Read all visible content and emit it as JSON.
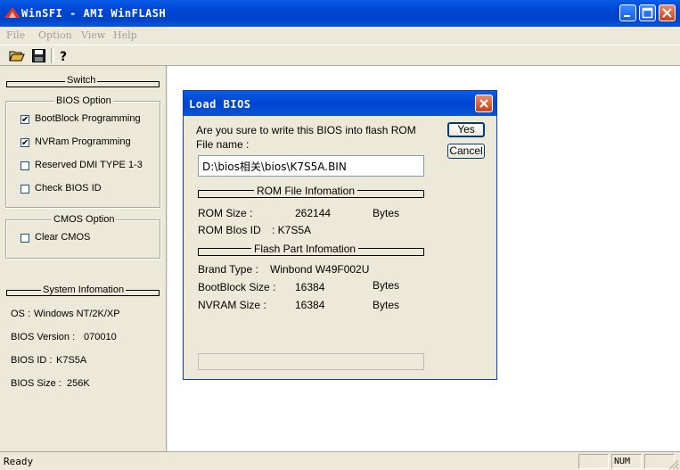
{
  "window": {
    "title": "WinSFI - AMI WinFLASH",
    "controls": [
      "minimize-icon",
      "maximize-icon",
      "close-icon"
    ]
  },
  "menu": {
    "items": [
      "File",
      "Option",
      "View",
      "Help"
    ]
  },
  "toolbar": {
    "buttons": [
      "open-folder-icon",
      "save-icon",
      "help-icon"
    ]
  },
  "left_panel": {
    "switch_heading": "Switch",
    "bios_option": {
      "title": "BIOS Option",
      "items": [
        {
          "label": "BootBlock Programming",
          "checked": true
        },
        {
          "label": "NVRam Programming",
          "checked": true
        },
        {
          "label": "Reserved DMI TYPE 1-3",
          "checked": false
        },
        {
          "label": "Check BIOS ID",
          "checked": false
        }
      ]
    },
    "cmos_option": {
      "title": "CMOS Option",
      "items": [
        {
          "label": "Clear CMOS",
          "checked": false
        }
      ]
    },
    "system_info": {
      "heading": "System Infomation",
      "os_label": "OS :",
      "os_value": "Windows NT/2K/XP",
      "bios_version_label": "BIOS Version :",
      "bios_version_value": "070010",
      "bios_id_label": "BIOS ID :",
      "bios_id_value": "K7S5A",
      "bios_size_label": "BIOS Size :",
      "bios_size_value": "256K"
    }
  },
  "dialog": {
    "title": "Load BIOS",
    "prompt": "Are you sure to write this BIOS into flash ROM",
    "file_name_label": "File name :",
    "file_name_value": "D:\\bios相关\\bios\\K7S5A.BIN",
    "yes_button": "Yes",
    "cancel_button": "Cancel",
    "rom_file_heading": "ROM File Infomation",
    "rom_size_label": "ROM Size :",
    "rom_size_value": "262144",
    "rom_size_unit": "Bytes",
    "rom_bios_id_label": "ROM BIos ID",
    "rom_bios_id_value": ":  K7S5A",
    "flash_part_heading": "Flash Part Infomation",
    "brand_type_label": "Brand Type :",
    "brand_type_value": "Winbond W49F002U",
    "bootblock_size_label": "BootBlock Size :",
    "bootblock_size_value": "16384",
    "bootblock_size_unit": "Bytes",
    "nvram_size_label": "NVRAM Size :",
    "nvram_size_value": "16384",
    "nvram_size_unit": "Bytes",
    "progress": 0
  },
  "statusbar": {
    "status": "Ready",
    "num_indicator": "NUM"
  }
}
